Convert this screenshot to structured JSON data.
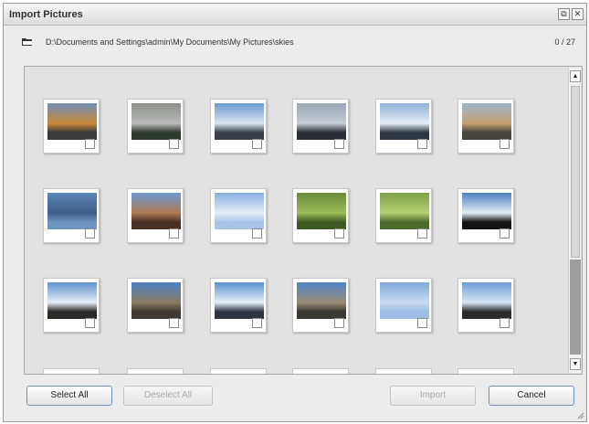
{
  "window": {
    "title": "Import Pictures",
    "restore_glyph": "⧉",
    "close_glyph": "✕"
  },
  "pathbar": {
    "icon": "folder-icon",
    "path": "D:\\Documents and Settings\\admin\\My Documents\\My Pictures\\skies",
    "count": "0 / 27"
  },
  "scrollbar": {
    "up_glyph": "▲",
    "down_glyph": "▼"
  },
  "thumbnails": [
    {
      "sky": "#6e8fb5",
      "ground": "#3b3b3b",
      "accent": "#c98a3a"
    },
    {
      "sky": "#8a8f8a",
      "ground": "#2f3a2f",
      "accent": "#b9b9b9"
    },
    {
      "sky": "#6d9ad0",
      "ground": "#3a3f47",
      "accent": "#d8e4f0"
    },
    {
      "sky": "#9aa6b3",
      "ground": "#2a2d33",
      "accent": "#c5ccd4"
    },
    {
      "sky": "#8eb2d8",
      "ground": "#2e3642",
      "accent": "#e5edf5"
    },
    {
      "sky": "#9bb7cf",
      "ground": "#47433e",
      "accent": "#c7a171"
    },
    {
      "sky": "#5c87b9",
      "ground": "#6f95c2",
      "accent": "#3f5d86"
    },
    {
      "sky": "#6e9bd2",
      "ground": "#4a2f24",
      "accent": "#b07a55"
    },
    {
      "sky": "#86aee0",
      "ground": "#a8c3e6",
      "accent": "#e6eef8"
    },
    {
      "sky": "#6b8a3a",
      "ground": "#3e5a22",
      "accent": "#9cbd5a"
    },
    {
      "sky": "#7fa04a",
      "ground": "#4c6b2a",
      "accent": "#b6cf72"
    },
    {
      "sky": "#4d7ec0",
      "ground": "#141414",
      "accent": "#e4edf6"
    },
    {
      "sky": "#5e93d0",
      "ground": "#2c2a28",
      "accent": "#e8eef6"
    },
    {
      "sky": "#4e82c4",
      "ground": "#3e3a33",
      "accent": "#8a7b62"
    },
    {
      "sky": "#5a90d3",
      "ground": "#2d3440",
      "accent": "#e8f0f8"
    },
    {
      "sky": "#4f84c6",
      "ground": "#3a3833",
      "accent": "#9a8c75"
    },
    {
      "sky": "#7fa8da",
      "ground": "#9dbde4",
      "accent": "#c8dbf0"
    },
    {
      "sky": "#6b9dd4",
      "ground": "#2b2b2b",
      "accent": "#d7e5f3"
    }
  ],
  "partial_row_count": 6,
  "buttons": {
    "select_all": "Select All",
    "deselect_all": "Deselect All",
    "import": "Import",
    "cancel": "Cancel"
  }
}
